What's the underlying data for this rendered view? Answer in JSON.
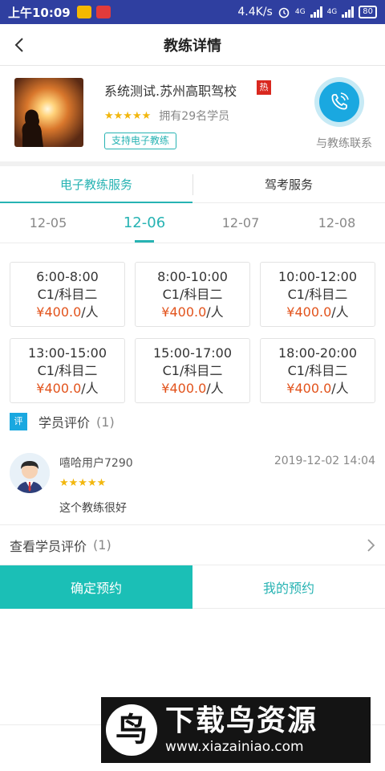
{
  "status_bar": {
    "time": "上午10:09",
    "speed": "4.4K/s",
    "net1": "4G",
    "net2": "4G",
    "battery": "80"
  },
  "header": {
    "title": "教练详情"
  },
  "coach": {
    "name": "系统测试.苏州高职驾校",
    "hot_badge": "热",
    "stars": "★★★★★",
    "students": "拥有29名学员",
    "tag": "支持电子教练",
    "call_label": "与教练联系"
  },
  "service_tabs": [
    {
      "label": "电子教练服务",
      "active": true
    },
    {
      "label": "驾考服务",
      "active": false
    }
  ],
  "date_tabs": [
    {
      "label": "12-05"
    },
    {
      "label": "12-06",
      "active": true
    },
    {
      "label": "12-07"
    },
    {
      "label": "12-08"
    }
  ],
  "slots": [
    {
      "time": "6:00-8:00",
      "subject": "C1/科目二",
      "price": "¥400.0",
      "unit": "/人"
    },
    {
      "time": "8:00-10:00",
      "subject": "C1/科目二",
      "price": "¥400.0",
      "unit": "/人"
    },
    {
      "time": "10:00-12:00",
      "subject": "C1/科目二",
      "price": "¥400.0",
      "unit": "/人"
    },
    {
      "time": "13:00-15:00",
      "subject": "C1/科目二",
      "price": "¥400.0",
      "unit": "/人"
    },
    {
      "time": "15:00-17:00",
      "subject": "C1/科目二",
      "price": "¥400.0",
      "unit": "/人"
    },
    {
      "time": "18:00-20:00",
      "subject": "C1/科目二",
      "price": "¥400.0",
      "unit": "/人"
    }
  ],
  "reviews_section": {
    "icon_text": "评",
    "title": "学员评价",
    "count": "(1)"
  },
  "review": {
    "user": "嘻哈用户7290",
    "date": "2019-12-02 14:04",
    "stars": "★★★★★",
    "content": "这个教练很好"
  },
  "more_reviews": {
    "label": "查看学员评价",
    "count": "(1)"
  },
  "actions": {
    "confirm": "确定预约",
    "mine": "我的预约"
  },
  "watermark": {
    "logo_char": "鸟",
    "title": "下载鸟资源",
    "url": "www.xiazainiao.com"
  },
  "colors": {
    "accent": "#27b3b3",
    "price": "#e2531c",
    "call": "#1aa8e0",
    "confirm": "#1bbfb6",
    "statusbar": "#2f3fa0"
  }
}
